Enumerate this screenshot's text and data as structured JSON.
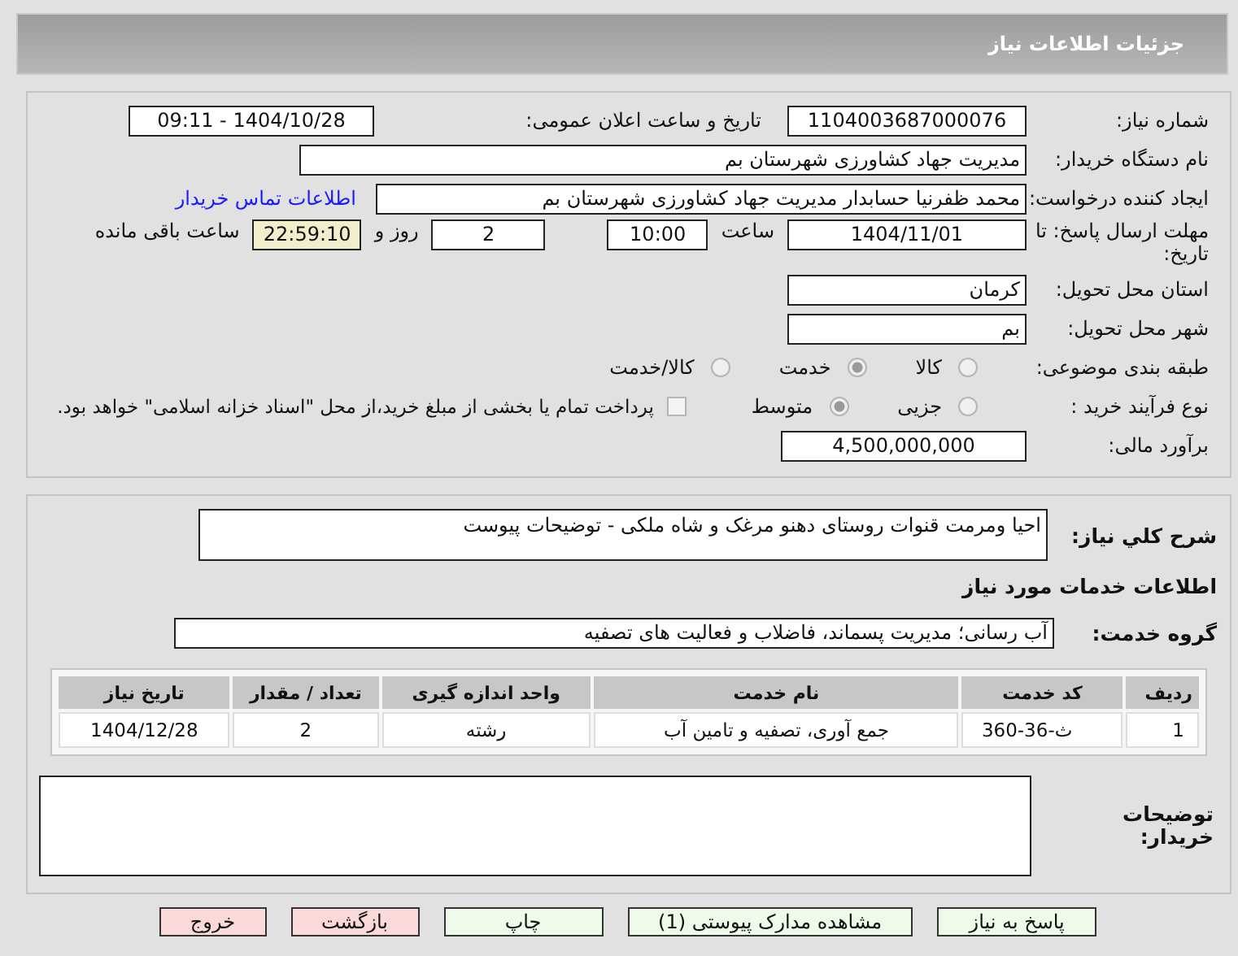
{
  "header": {
    "title": "جزئیات اطلاعات نیاز"
  },
  "need_number": {
    "label": "شماره نیاز:",
    "value": "1104003687000076"
  },
  "announce": {
    "label": "تاریخ و ساعت اعلان عمومی:",
    "value": "1404/10/28 - 09:11"
  },
  "buyer_org": {
    "label": "نام دستگاه خریدار:",
    "value": "مدیریت جهاد کشاورزی شهرستان بم"
  },
  "creator": {
    "label": "ایجاد کننده درخواست:",
    "value": "محمد ظفرنیا حسابدار مدیریت جهاد کشاورزی شهرستان بم",
    "link": "اطلاعات تماس خریدار"
  },
  "deadline": {
    "label": "مهلت ارسال پاسخ: تا تاریخ:",
    "date": "1404/11/01",
    "time_label": "ساعت",
    "time": "10:00",
    "days": "2",
    "days_label": "روز و",
    "remaining": "22:59:10",
    "remaining_label": "ساعت باقی مانده"
  },
  "province": {
    "label": "استان محل تحویل:",
    "value": "کرمان"
  },
  "city": {
    "label": "شهر محل تحویل:",
    "value": "بم"
  },
  "category": {
    "label": "طبقه بندی موضوعی:",
    "options": [
      {
        "label": "کالا",
        "selected": false
      },
      {
        "label": "خدمت",
        "selected": true
      },
      {
        "label": "کالا/خدمت",
        "selected": false
      }
    ]
  },
  "process": {
    "label": "نوع فرآیند خرید :",
    "options": [
      {
        "label": "جزیی",
        "selected": false
      },
      {
        "label": "متوسط",
        "selected": true
      }
    ],
    "payment_checkbox": {
      "label": "پرداخت تمام یا بخشی از مبلغ خرید،از محل \"اسناد خزانه اسلامی\" خواهد بود.",
      "checked": false
    }
  },
  "estimate": {
    "label": "برآورد مالی:",
    "value": "4,500,000,000"
  },
  "description": {
    "label": "شرح کلي نياز:",
    "value": "احیا ومرمت قنوات روستای دهنو مرغک و شاه ملکی - توضیحات پیوست"
  },
  "services_heading": "اطلاعات خدمات مورد نیاز",
  "service_group": {
    "label": "گروه خدمت:",
    "value": "آب رسانی؛ مدیریت پسماند، فاضلاب و فعالیت های تصفیه"
  },
  "table": {
    "columns": [
      "ردیف",
      "کد خدمت",
      "نام خدمت",
      "واحد اندازه گیری",
      "تعداد / مقدار",
      "تاریخ نیاز"
    ],
    "rows": [
      [
        "1",
        "ث-36-360",
        "جمع آوری، تصفیه و تامین آب",
        "رشته",
        "2",
        "1404/12/28"
      ]
    ]
  },
  "buyer_notes": {
    "label": "توضیحات خریدار:"
  },
  "buttons": [
    {
      "label": "پاسخ به نیاز",
      "kind": "green"
    },
    {
      "label": "مشاهده مدارک پیوستی (1)",
      "kind": "green"
    },
    {
      "label": "چاپ",
      "kind": "green"
    },
    {
      "label": "بازگشت",
      "kind": "red"
    },
    {
      "label": "خروج",
      "kind": "red"
    }
  ]
}
